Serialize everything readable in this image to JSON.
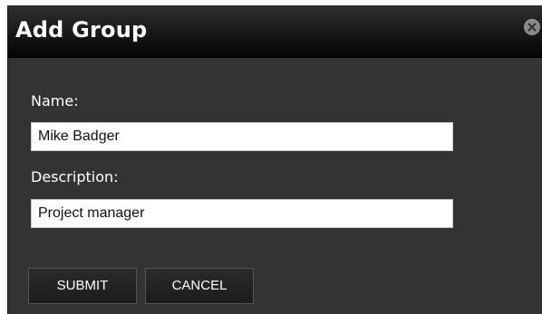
{
  "dialog": {
    "title": "Add Group",
    "close_icon": "close-circle-icon"
  },
  "form": {
    "name_label": "Name:",
    "name_value": "Mike Badger",
    "description_label": "Description:",
    "description_value": "Project manager"
  },
  "actions": {
    "submit_label": "SUBMIT",
    "cancel_label": "CANCEL"
  },
  "colors": {
    "dialog_background": "#333333",
    "titlebar_top": "#2f2f2f",
    "titlebar_bottom": "#050505",
    "text": "#ffffff",
    "field_background": "#ffffff"
  }
}
